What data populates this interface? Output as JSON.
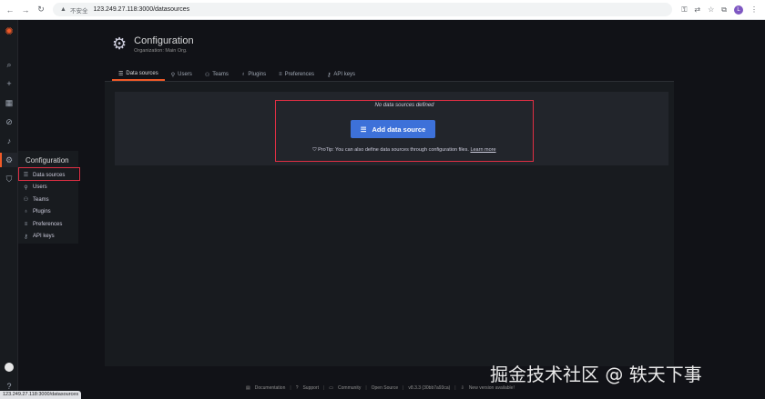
{
  "browser": {
    "insecure_label": "不安全",
    "url": "123.249.27.118:3000/datasources",
    "profile_initial": "L"
  },
  "flyout": {
    "title": "Configuration",
    "items": [
      {
        "label": "Data sources",
        "icon": "database-icon"
      },
      {
        "label": "Users",
        "icon": "user-icon"
      },
      {
        "label": "Teams",
        "icon": "users-icon"
      },
      {
        "label": "Plugins",
        "icon": "plug-icon"
      },
      {
        "label": "Preferences",
        "icon": "sliders-icon"
      },
      {
        "label": "API keys",
        "icon": "key-icon"
      }
    ]
  },
  "page": {
    "title": "Configuration",
    "subtitle": "Organization: Main Org."
  },
  "tabs": [
    {
      "label": "Data sources",
      "active": true
    },
    {
      "label": "Users"
    },
    {
      "label": "Teams"
    },
    {
      "label": "Plugins"
    },
    {
      "label": "Preferences"
    },
    {
      "label": "API keys"
    }
  ],
  "empty_state": {
    "message": "No data sources defined",
    "button_label": "Add data source",
    "protip": "ProTip: You can also define data sources through configuration files.",
    "learn_more": "Learn more"
  },
  "footer": {
    "documentation": "Documentation",
    "support": "Support",
    "community": "Community",
    "open_source": "Open Source",
    "version": "v8.3.3 (30bb7a93ca)",
    "new_version": "New version available!"
  },
  "status_url": "123.249.27.118:3000/datasources",
  "watermark": "掘金技术社区 @ 轶天下事",
  "colors": {
    "accent": "#f05a28",
    "primary_button": "#3d71d9",
    "highlight_box": "#e02f44"
  }
}
